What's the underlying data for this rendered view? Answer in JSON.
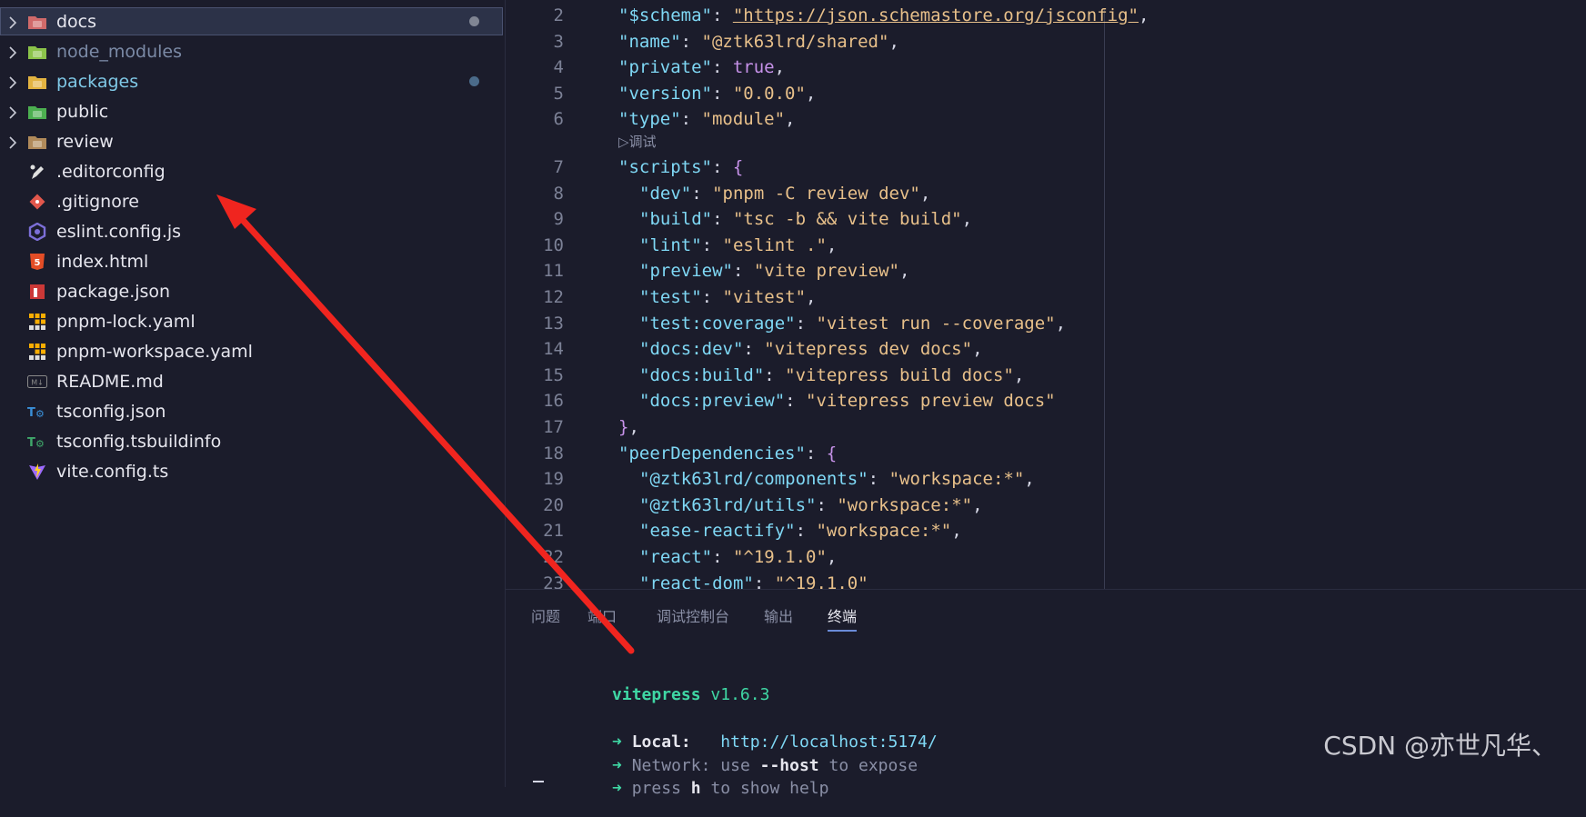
{
  "explorer": {
    "items": [
      {
        "name": "docs",
        "type": "folder",
        "icon": "docs-folder-icon",
        "color": "#d06a6a",
        "selected": true,
        "dot": true,
        "style": "normal"
      },
      {
        "name": "node_modules",
        "type": "folder",
        "icon": "node-folder-icon",
        "color": "#8bc34a",
        "selected": false,
        "dot": false,
        "style": "dim"
      },
      {
        "name": "packages",
        "type": "folder",
        "icon": "packages-folder-icon",
        "color": "#e3b341",
        "selected": false,
        "dot": true,
        "style": "mod"
      },
      {
        "name": "public",
        "type": "folder",
        "icon": "public-folder-icon",
        "color": "#4caf50",
        "selected": false,
        "dot": false,
        "style": "normal"
      },
      {
        "name": "review",
        "type": "folder",
        "icon": "folder-icon",
        "color": "#b08a5a",
        "selected": false,
        "dot": false,
        "style": "normal"
      },
      {
        "name": ".editorconfig",
        "type": "file",
        "icon": "editorconfig-icon",
        "color": "#e0e0e0",
        "style": "normal"
      },
      {
        "name": ".gitignore",
        "type": "file",
        "icon": "git-icon",
        "color": "#e2574c",
        "style": "normal"
      },
      {
        "name": "eslint.config.js",
        "type": "file",
        "icon": "eslint-icon",
        "color": "#7c6fd8",
        "style": "normal"
      },
      {
        "name": "index.html",
        "type": "file",
        "icon": "html5-icon",
        "color": "#e44d26",
        "style": "normal"
      },
      {
        "name": "package.json",
        "type": "file",
        "icon": "npm-icon",
        "color": "#cb3837",
        "style": "normal"
      },
      {
        "name": "pnpm-lock.yaml",
        "type": "file",
        "icon": "pnpm-icon",
        "color": "#f9ad00",
        "style": "normal"
      },
      {
        "name": "pnpm-workspace.yaml",
        "type": "file",
        "icon": "pnpm-icon",
        "color": "#f9ad00",
        "style": "normal"
      },
      {
        "name": "README.md",
        "type": "file",
        "icon": "markdown-icon",
        "color": "#8a8a8a",
        "style": "normal"
      },
      {
        "name": "tsconfig.json",
        "type": "file",
        "icon": "tsconfig-icon",
        "color": "#3a8fd8",
        "style": "normal"
      },
      {
        "name": "tsconfig.tsbuildinfo",
        "type": "file",
        "icon": "tsbuildinfo-icon",
        "color": "#3fa76a",
        "style": "normal"
      },
      {
        "name": "vite.config.ts",
        "type": "file",
        "icon": "vite-icon",
        "color": "#9d6bff",
        "style": "normal"
      }
    ]
  },
  "editor": {
    "codelens": "▷调试",
    "lines": [
      {
        "n": "2",
        "indent": 1,
        "tokens": [
          [
            "k",
            "\"$schema\""
          ],
          [
            "p",
            ": "
          ],
          [
            "u",
            "\"https://json.schemastore.org/jsconfig\""
          ],
          [
            "p",
            ","
          ]
        ]
      },
      {
        "n": "3",
        "indent": 1,
        "tokens": [
          [
            "k",
            "\"name\""
          ],
          [
            "p",
            ": "
          ],
          [
            "s",
            "\"@ztk63lrd/shared\""
          ],
          [
            "p",
            ","
          ]
        ]
      },
      {
        "n": "4",
        "indent": 1,
        "tokens": [
          [
            "k",
            "\"private\""
          ],
          [
            "p",
            ": "
          ],
          [
            "b",
            "true"
          ],
          [
            "p",
            ","
          ]
        ]
      },
      {
        "n": "5",
        "indent": 1,
        "tokens": [
          [
            "k",
            "\"version\""
          ],
          [
            "p",
            ": "
          ],
          [
            "s",
            "\"0.0.0\""
          ],
          [
            "p",
            ","
          ]
        ]
      },
      {
        "n": "6",
        "indent": 1,
        "tokens": [
          [
            "k",
            "\"type\""
          ],
          [
            "p",
            ": "
          ],
          [
            "s",
            "\"module\""
          ],
          [
            "p",
            ","
          ]
        ]
      },
      {
        "n": "7",
        "indent": 1,
        "tokens": [
          [
            "k",
            "\"scripts\""
          ],
          [
            "p",
            ": "
          ],
          [
            "b",
            "{"
          ]
        ]
      },
      {
        "n": "8",
        "indent": 2,
        "tokens": [
          [
            "k",
            "\"dev\""
          ],
          [
            "p",
            ": "
          ],
          [
            "s",
            "\"pnpm -C review dev\""
          ],
          [
            "p",
            ","
          ]
        ]
      },
      {
        "n": "9",
        "indent": 2,
        "tokens": [
          [
            "k",
            "\"build\""
          ],
          [
            "p",
            ": "
          ],
          [
            "s",
            "\"tsc -b && vite build\""
          ],
          [
            "p",
            ","
          ]
        ]
      },
      {
        "n": "10",
        "indent": 2,
        "tokens": [
          [
            "k",
            "\"lint\""
          ],
          [
            "p",
            ": "
          ],
          [
            "s",
            "\"eslint .\""
          ],
          [
            "p",
            ","
          ]
        ]
      },
      {
        "n": "11",
        "indent": 2,
        "tokens": [
          [
            "k",
            "\"preview\""
          ],
          [
            "p",
            ": "
          ],
          [
            "s",
            "\"vite preview\""
          ],
          [
            "p",
            ","
          ]
        ]
      },
      {
        "n": "12",
        "indent": 2,
        "tokens": [
          [
            "k",
            "\"test\""
          ],
          [
            "p",
            ": "
          ],
          [
            "s",
            "\"vitest\""
          ],
          [
            "p",
            ","
          ]
        ]
      },
      {
        "n": "13",
        "indent": 2,
        "tokens": [
          [
            "k",
            "\"test:coverage\""
          ],
          [
            "p",
            ": "
          ],
          [
            "s",
            "\"vitest run --coverage\""
          ],
          [
            "p",
            ","
          ]
        ]
      },
      {
        "n": "14",
        "indent": 2,
        "tokens": [
          [
            "k",
            "\"docs:dev\""
          ],
          [
            "p",
            ": "
          ],
          [
            "s",
            "\"vitepress dev docs\""
          ],
          [
            "p",
            ","
          ]
        ]
      },
      {
        "n": "15",
        "indent": 2,
        "tokens": [
          [
            "k",
            "\"docs:build\""
          ],
          [
            "p",
            ": "
          ],
          [
            "s",
            "\"vitepress build docs\""
          ],
          [
            "p",
            ","
          ]
        ]
      },
      {
        "n": "16",
        "indent": 2,
        "tokens": [
          [
            "k",
            "\"docs:preview\""
          ],
          [
            "p",
            ": "
          ],
          [
            "s",
            "\"vitepress preview docs\""
          ]
        ]
      },
      {
        "n": "17",
        "indent": 1,
        "tokens": [
          [
            "b",
            "}"
          ],
          [
            "p",
            ","
          ]
        ]
      },
      {
        "n": "18",
        "indent": 1,
        "tokens": [
          [
            "k",
            "\"peerDependencies\""
          ],
          [
            "p",
            ": "
          ],
          [
            "b",
            "{"
          ]
        ]
      },
      {
        "n": "19",
        "indent": 2,
        "tokens": [
          [
            "k",
            "\"@ztk63lrd/components\""
          ],
          [
            "p",
            ": "
          ],
          [
            "s",
            "\"workspace:*\""
          ],
          [
            "p",
            ","
          ]
        ]
      },
      {
        "n": "20",
        "indent": 2,
        "tokens": [
          [
            "k",
            "\"@ztk63lrd/utils\""
          ],
          [
            "p",
            ": "
          ],
          [
            "s",
            "\"workspace:*\""
          ],
          [
            "p",
            ","
          ]
        ]
      },
      {
        "n": "21",
        "indent": 2,
        "tokens": [
          [
            "k",
            "\"ease-reactify\""
          ],
          [
            "p",
            ": "
          ],
          [
            "s",
            "\"workspace:*\""
          ],
          [
            "p",
            ","
          ]
        ]
      },
      {
        "n": "22",
        "indent": 2,
        "tokens": [
          [
            "k",
            "\"react\""
          ],
          [
            "p",
            ": "
          ],
          [
            "s",
            "\"^19.1.0\""
          ],
          [
            "p",
            ","
          ]
        ]
      },
      {
        "n": "23",
        "indent": 2,
        "tokens": [
          [
            "k",
            "\"react-dom\""
          ],
          [
            "p",
            ": "
          ],
          [
            "s",
            "\"^19.1.0\""
          ]
        ]
      }
    ]
  },
  "panel": {
    "tabs": [
      {
        "label": "问题",
        "active": false
      },
      {
        "label": "端口",
        "active": false
      },
      {
        "label": "调试控制台",
        "active": false
      },
      {
        "label": "输出",
        "active": false
      },
      {
        "label": "终端",
        "active": true
      }
    ],
    "terminal": {
      "app_name": "vitepress",
      "version": "v1.6.3",
      "arrow": "➜",
      "local_label": "Local:",
      "local_url": "http://localhost:5174/",
      "network_label": "Network:",
      "network_text1": "use",
      "network_flag": "--host",
      "network_text2": "to expose",
      "help_text1": "press",
      "help_key": "h",
      "help_text2": "to show help"
    }
  },
  "watermark": "CSDN @亦世凡华、",
  "annotation_color": "#f0251f"
}
